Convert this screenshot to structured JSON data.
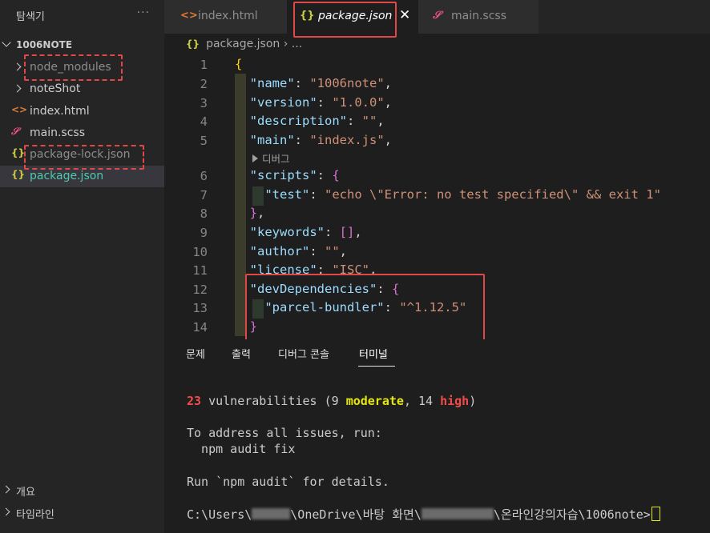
{
  "sidebar": {
    "header": "탐색기",
    "more": "···",
    "folder": "1006NOTE",
    "items": [
      {
        "label": "node_modules",
        "icon": "chevron-right-icon"
      },
      {
        "label": "noteShot",
        "icon": "chevron-right-icon"
      },
      {
        "label": "index.html",
        "icon": "html-file-icon",
        "glyph": "<>"
      },
      {
        "label": "main.scss",
        "icon": "scss-file-icon",
        "glyph": "𝒮"
      },
      {
        "label": "package-lock.json",
        "icon": "json-file-icon",
        "glyph": "{}"
      },
      {
        "label": "package.json",
        "icon": "json-file-icon",
        "glyph": "{}"
      }
    ],
    "sections": [
      "개요",
      "타임라인"
    ]
  },
  "tabs": [
    {
      "label": "index.html",
      "glyph": "<>"
    },
    {
      "label": "package.json",
      "glyph": "{}",
      "active": true,
      "close": "✕"
    },
    {
      "label": "main.scss",
      "glyph": "𝒮"
    }
  ],
  "breadcrumb": {
    "glyph": "{}",
    "file": "package.json",
    "sep": "›",
    "more": "..."
  },
  "codelens": "디버그",
  "code": {
    "line_numbers": [
      "1",
      "2",
      "3",
      "4",
      "5",
      "6",
      "7",
      "8",
      "9",
      "10",
      "11",
      "12",
      "13",
      "14"
    ],
    "name_key": "\"name\"",
    "name_val": "\"1006note\"",
    "version_key": "\"version\"",
    "version_val": "\"1.0.0\"",
    "description_key": "\"description\"",
    "description_val": "\"\"",
    "main_key": "\"main\"",
    "main_val": "\"index.js\"",
    "scripts_key": "\"scripts\"",
    "test_key": "\"test\"",
    "test_val": "\"echo \\\"Error: no test specified\\\" && exit 1\"",
    "keywords_key": "\"keywords\"",
    "author_key": "\"author\"",
    "author_val": "\"\"",
    "license_key": "\"license\"",
    "license_val": "\"ISC\"",
    "devdeps_key": "\"devDependencies\"",
    "parcel_key": "\"parcel-bundler\"",
    "parcel_val": "\"^1.12.5\""
  },
  "panel": {
    "tabs": [
      "문제",
      "출력",
      "디버그 콘솔",
      "터미널"
    ],
    "active_tab": "터미널",
    "terminal": {
      "vuln_count": "23",
      "vuln_text": " vulnerabilities (9 ",
      "moderate": "moderate",
      "comma": ", 14 ",
      "high": "high",
      "close": ")",
      "line2": "To address all issues, run:",
      "line3": "  npm audit fix",
      "line4": "Run `npm audit` for details.",
      "prompt_a": "C:\\Users\\",
      "prompt_b": "\\OneDrive\\바탕 화면\\",
      "prompt_c": "\\온라인강의자습\\1006note>"
    }
  },
  "colors": {
    "annotation": "#e04848",
    "json_icon": "#cbcb41",
    "html_icon": "#e37933",
    "scss_icon": "#f55385"
  }
}
